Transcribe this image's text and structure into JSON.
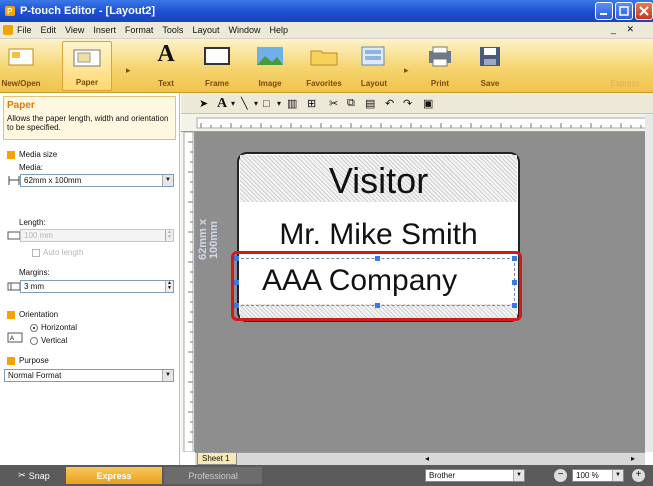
{
  "window": {
    "title": "P-touch Editor - [Layout2]"
  },
  "menu": [
    "File",
    "Edit",
    "View",
    "Insert",
    "Format",
    "Tools",
    "Layout",
    "Window",
    "Help"
  ],
  "ribbon": {
    "buttons": [
      "New/Open",
      "Paper",
      "Text",
      "Frame",
      "Image",
      "Favorites",
      "Layout",
      "Print",
      "Save"
    ],
    "express_label": "Express"
  },
  "paper_panel": {
    "title": "Paper",
    "description": "Allows the paper length, width and orientation to be specified.",
    "media_size_heading": "Media size",
    "media_label": "Media:",
    "media_value": "62mm x 100mm",
    "length_label": "Length:",
    "length_value": "100 mm",
    "auto_length_label": "Auto length",
    "margins_label": "Margins:",
    "margins_value": "3 mm",
    "orientation_heading": "Orientation",
    "orientation_options": [
      "Horizontal",
      "Vertical"
    ],
    "orientation_selected": "Horizontal",
    "purpose_heading": "Purpose",
    "purpose_value": "Normal Format"
  },
  "canvas": {
    "size_label_1": "62mm",
    "size_label_2": "x 100mm",
    "text_objects": [
      "Visitor",
      "Mr. Mike Smith",
      "AAA Company"
    ]
  },
  "sheet_tab": "Sheet 1",
  "status": {
    "modes": [
      "Snap",
      "Express",
      "Professional"
    ],
    "active_mode": "Express",
    "printer": "Brother",
    "zoom": "100 %"
  },
  "colors": {
    "ribbon_accent": "#f0c34a",
    "selection_red": "#d11a1a",
    "title_blue": "#1b4fd0"
  }
}
